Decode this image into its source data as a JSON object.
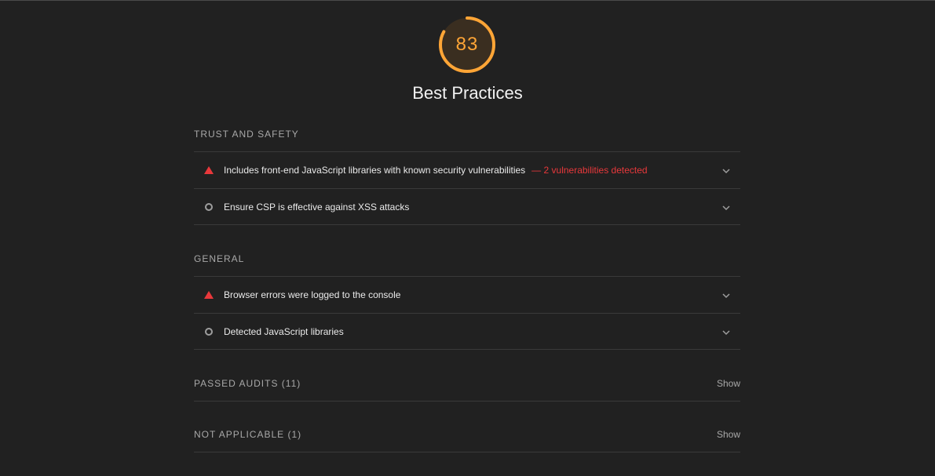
{
  "score": {
    "value": "83",
    "fraction": 0.83,
    "color": "#ffa536"
  },
  "category": {
    "title": "Best Practices"
  },
  "groups": [
    {
      "title": "TRUST AND SAFETY",
      "audits": [
        {
          "status": "fail",
          "title": "Includes front-end JavaScript libraries with known security vulnerabilities",
          "display": "— 2 vulnerabilities detected"
        },
        {
          "status": "informative",
          "title": "Ensure CSP is effective against XSS attacks",
          "display": ""
        }
      ]
    },
    {
      "title": "GENERAL",
      "audits": [
        {
          "status": "fail",
          "title": "Browser errors were logged to the console",
          "display": ""
        },
        {
          "status": "informative",
          "title": "Detected JavaScript libraries",
          "display": ""
        }
      ]
    }
  ],
  "clumps": [
    {
      "title": "PASSED AUDITS (11)",
      "action": "Show"
    },
    {
      "title": "NOT APPLICABLE (1)",
      "action": "Show"
    }
  ],
  "colors": {
    "fail": "#e8383b",
    "average": "#ffa536",
    "background": "#212121"
  },
  "icons": {
    "fail": "warning-triangle-icon",
    "informative": "info-circle-icon",
    "expand": "chevron-down-icon"
  }
}
